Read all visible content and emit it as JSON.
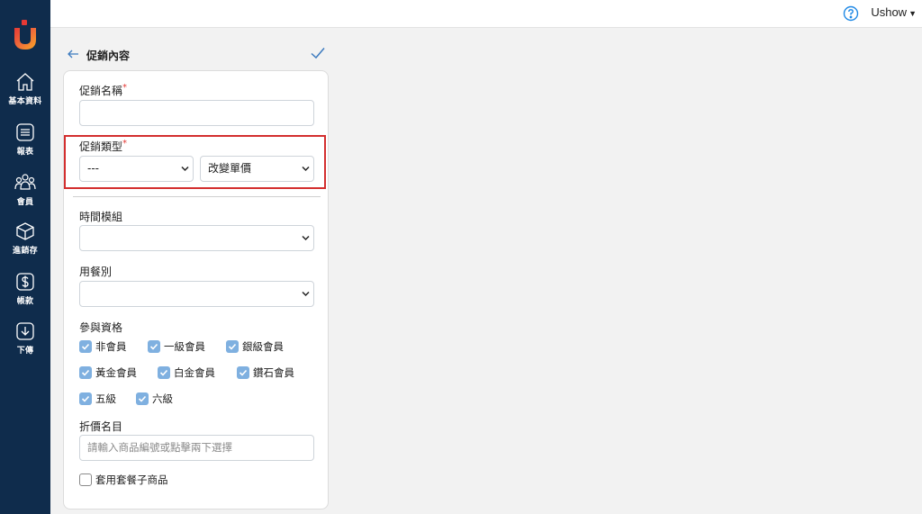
{
  "colors": {
    "sidebar": "#0f2c4c",
    "accent": "#3d7bbf",
    "checkbox": "#7fb0e0",
    "highlight": "#d32f2f",
    "required": "#e53935"
  },
  "sidebar": {
    "logo": "u-logo",
    "items": [
      {
        "label": "基本資料",
        "icon": "home-icon"
      },
      {
        "label": "報表",
        "icon": "report-icon"
      },
      {
        "label": "會員",
        "icon": "members-icon"
      },
      {
        "label": "進銷存",
        "icon": "box-icon"
      },
      {
        "label": "帳款",
        "icon": "dollar-icon"
      },
      {
        "label": "下傳",
        "icon": "download-icon"
      }
    ]
  },
  "topbar": {
    "help_icon": "question-icon",
    "user": "Ushow",
    "caret": "▼"
  },
  "panel": {
    "title": "促銷內容",
    "back_icon": "arrow-left-icon",
    "confirm_icon": "check-icon"
  },
  "form": {
    "promo_name": {
      "label": "促銷名稱",
      "required": "*",
      "value": ""
    },
    "promo_type": {
      "label": "促銷類型",
      "required": "*",
      "select1": "---",
      "select2": "改變單價"
    },
    "time_module": {
      "label": "時間模組",
      "value": ""
    },
    "meal_type": {
      "label": "用餐別",
      "value": ""
    },
    "eligibility": {
      "label": "參與資格",
      "options": [
        {
          "label": "非會員",
          "checked": true
        },
        {
          "label": "一級會員",
          "checked": true
        },
        {
          "label": "銀級會員",
          "checked": true
        },
        {
          "label": "黃金會員",
          "checked": true
        },
        {
          "label": "白金會員",
          "checked": true
        },
        {
          "label": "鑽石會員",
          "checked": true
        },
        {
          "label": "五級",
          "checked": true
        },
        {
          "label": "六級",
          "checked": true
        }
      ]
    },
    "discount_items": {
      "label": "折價名目",
      "placeholder": "請輸入商品編號或點擊兩下選擇"
    },
    "combo": {
      "label": "套用套餐子商品",
      "checked": false
    }
  }
}
